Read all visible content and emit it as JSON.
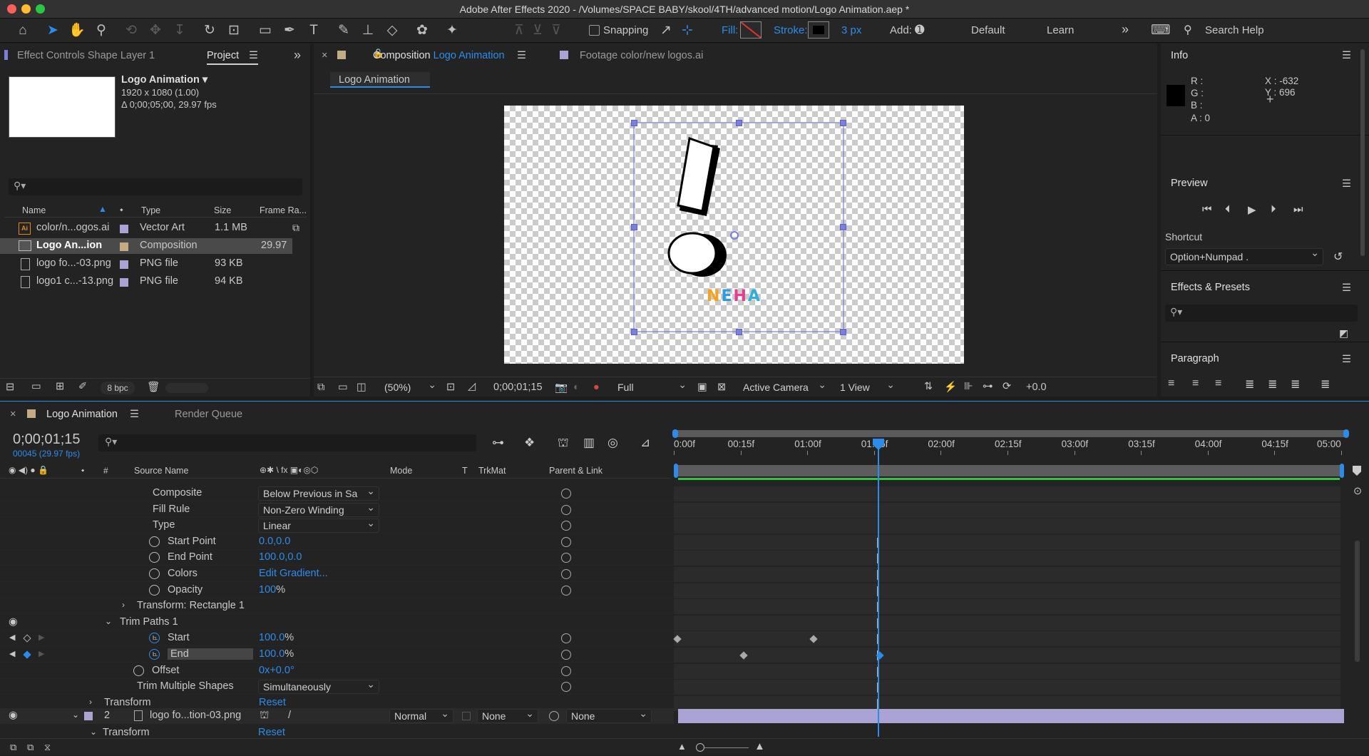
{
  "window": {
    "title": "Adobe After Effects 2020 - /Volumes/SPACE BABY/skool/4TH/advanced motion/Logo Animation.aep *"
  },
  "toolbar": {
    "snapping": "Snapping",
    "fill_label": "Fill:",
    "stroke_label": "Stroke:",
    "stroke_width": "3 px",
    "add_label": "Add:",
    "workspace_default": "Default",
    "workspace_learn": "Learn",
    "search_placeholder": "Search Help"
  },
  "left_panel": {
    "tab_effect_controls": "Effect Controls Shape Layer 1",
    "tab_project": "Project",
    "comp_name": "Logo Animation ▾",
    "comp_dims": "1920 x 1080 (1.00)",
    "comp_duration": "Δ 0;00;05;00, 29.97 fps",
    "columns": [
      "Name",
      "Type",
      "Size",
      "Frame Ra..."
    ],
    "items": [
      {
        "name": "color/n...ogos.ai",
        "type": "Vector Art",
        "size": "1.1 MB",
        "fps": "",
        "icon": "Ai"
      },
      {
        "name": "Logo An...ion",
        "type": "Composition",
        "size": "",
        "fps": "29.97",
        "icon": "comp"
      },
      {
        "name": "logo fo...-03.png",
        "type": "PNG file",
        "size": "93 KB",
        "fps": "",
        "icon": "file"
      },
      {
        "name": "logo1 c...-13.png",
        "type": "PNG file",
        "size": "94 KB",
        "fps": "",
        "icon": "file"
      }
    ],
    "bpc": "8 bpc"
  },
  "viewer": {
    "tab_comp_prefix": "Composition",
    "tab_comp_name": "Logo Animation",
    "tab_footage": "Footage color/new logos.ai",
    "crumb": "Logo Animation",
    "logo_text": [
      "N",
      "E",
      "H",
      "A"
    ],
    "logo_colors": [
      "#f7a21b",
      "#2d9be0",
      "#e73d8f",
      "#30aee0"
    ],
    "zoom": "(50%)",
    "timecode": "0;00;01;15",
    "resolution": "Full",
    "camera": "Active Camera",
    "views": "1 View",
    "exposure": "+0.0"
  },
  "info": {
    "title": "Info",
    "r": "R :",
    "g": "G :",
    "b": "B :",
    "a": "A :  0",
    "x": "X : -632",
    "y": "Y :  696"
  },
  "preview": {
    "title": "Preview",
    "shortcut_label": "Shortcut",
    "shortcut_value": "Option+Numpad ."
  },
  "effects": {
    "title": "Effects & Presets"
  },
  "paragraph": {
    "title": "Paragraph"
  },
  "timeline": {
    "tab_name": "Logo Animation",
    "tab_render": "Render Queue",
    "timecode": "0;00;01;15",
    "frame": "00045 (29.97 fps)",
    "columns": {
      "source": "Source Name",
      "mode": "Mode",
      "t": "T",
      "trkmat": "TrkMat",
      "parent": "Parent & Link"
    },
    "ruler": [
      "0:00f",
      "00:15f",
      "01:00f",
      "01:15f",
      "02:00f",
      "02:15f",
      "03:00f",
      "03:15f",
      "04:00f",
      "04:15f",
      "05:00"
    ],
    "props": [
      {
        "label": "Composite",
        "value": "Below Previous in Sa",
        "kind": "dd"
      },
      {
        "label": "Fill Rule",
        "value": "Non-Zero Winding",
        "kind": "dd"
      },
      {
        "label": "Type",
        "value": "Linear",
        "kind": "dd"
      },
      {
        "label": "Start Point",
        "value": "0.0,0.0",
        "kind": "val"
      },
      {
        "label": "End Point",
        "value": "100.0,0.0",
        "kind": "val"
      },
      {
        "label": "Colors",
        "value": "Edit Gradient...",
        "kind": "val"
      },
      {
        "label": "Opacity",
        "value": "100",
        "unit": "%",
        "kind": "val"
      },
      {
        "label": "Transform: Rectangle 1",
        "kind": "group"
      },
      {
        "label": "Trim Paths 1",
        "kind": "group"
      },
      {
        "label": "Start",
        "value": "100.0",
        "unit": "%",
        "kind": "val"
      },
      {
        "label": "End",
        "value": "100.0",
        "unit": "%",
        "kind": "val"
      },
      {
        "label": "Offset",
        "value": "0x+0.0°",
        "kind": "val"
      },
      {
        "label": "Trim Multiple Shapes",
        "value": "Simultaneously",
        "kind": "dd"
      },
      {
        "label": "Transform",
        "value": "Reset",
        "kind": "val"
      }
    ],
    "layer2": {
      "num": "2",
      "name": "logo fo...tion-03.png",
      "mode": "Normal",
      "trkmat": "None",
      "parent": "None"
    },
    "layer2_transform": {
      "label": "Transform",
      "value": "Reset"
    }
  }
}
